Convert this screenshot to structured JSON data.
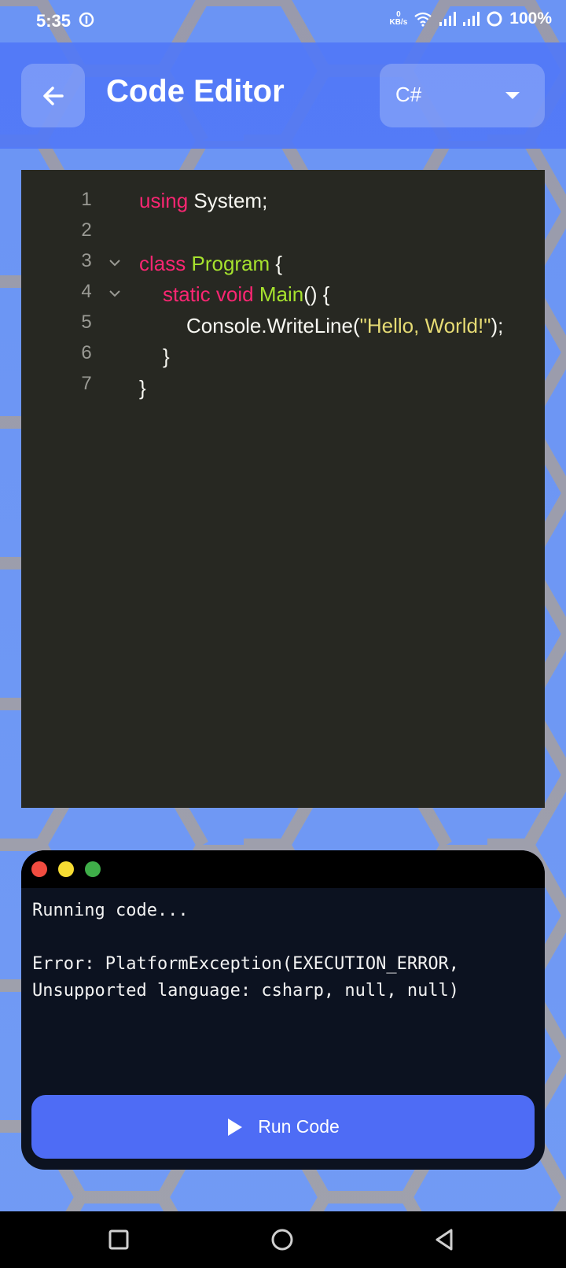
{
  "status_bar": {
    "time": "5:35",
    "net_speed_value": "0",
    "net_speed_unit": "KB/s",
    "battery": "100%",
    "icons": [
      "app-notification-icon",
      "wifi-icon",
      "signal-icon",
      "signal-icon",
      "battery-ring-icon"
    ]
  },
  "header": {
    "title": "Code Editor",
    "language": "C#"
  },
  "editor": {
    "line_numbers": [
      "1",
      "2",
      "3",
      "4",
      "5",
      "6",
      "7"
    ],
    "code": {
      "line1_kw": "using",
      "line1_rest": " System;",
      "line3_kw": "class",
      "line3_sp": " ",
      "line3_cls": "Program",
      "line3_rest": " {",
      "line4_kw": "static void",
      "line4_sp": " ",
      "line4_cls": "Main",
      "line4_rest": "() {",
      "line5_pre": "Console.WriteLine(",
      "line5_str": "\"Hello, World!\"",
      "line5_post": ");",
      "line6": "}",
      "line7": "}"
    }
  },
  "console": {
    "output": "Running code...\n\nError: PlatformException(EXECUTION_ERROR,\nUnsupported language: csharp, null, null)",
    "run_label": "Run Code"
  },
  "colors": {
    "accent": "#4e6cf5",
    "header": "#5279f6",
    "editor_bg": "#272822",
    "keyword": "#f92672",
    "class_name": "#a6e22e",
    "string": "#e6db74"
  }
}
